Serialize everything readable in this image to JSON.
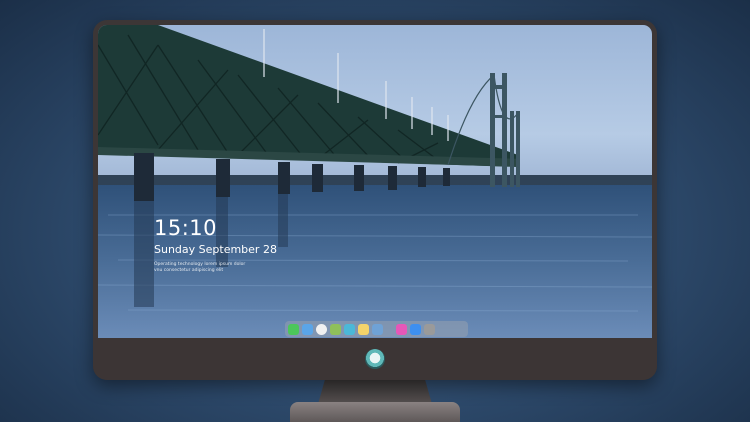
{
  "lock_screen": {
    "time": "15:10",
    "date": "Sunday September 28",
    "notice_line1": "Operating technology lorem ipsum dolor",
    "notice_line2": "vnu consectetur adipiscing elit"
  },
  "dock": {
    "apps": [
      {
        "name": "messages-icon",
        "color": "#4cc75b"
      },
      {
        "name": "finder-icon",
        "color": "#5aa5e8"
      },
      {
        "name": "safari-icon",
        "color": "#f1f1f1"
      },
      {
        "name": "maps-icon",
        "color": "#8fc05a"
      },
      {
        "name": "notes-icon",
        "color": "#4bb8d8"
      },
      {
        "name": "photos-icon",
        "color": "#f3d36a"
      },
      {
        "name": "keynote-icon",
        "color": "#6fa2d6"
      },
      {
        "name": "music-icon",
        "color": "#e657b8"
      },
      {
        "name": "app-store-icon",
        "color": "#3d8ff0"
      },
      {
        "name": "camera-icon",
        "color": "#9a9a9a"
      }
    ]
  },
  "colors": {
    "bezel": "#3c3636",
    "background": "#2c4869"
  }
}
